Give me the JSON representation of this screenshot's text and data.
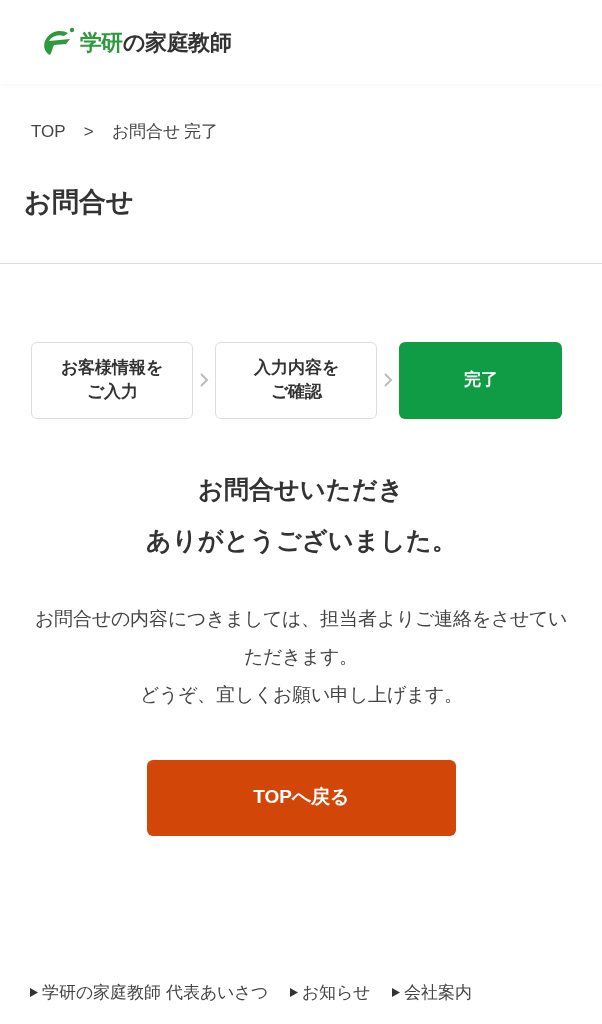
{
  "logo": {
    "accent": "学研",
    "rest": "の家庭教師"
  },
  "breadcrumb": [
    {
      "label": "TOP"
    },
    {
      "label": "お問合せ 完了"
    }
  ],
  "breadcrumb_separator": ">",
  "page_title": "お問合せ",
  "steps": [
    {
      "lines": [
        "お客様情報を",
        "ご入力"
      ],
      "selected": false
    },
    {
      "lines": [
        "入力内容を",
        "ご確認"
      ],
      "selected": false
    },
    {
      "lines": [
        "完了"
      ],
      "selected": true
    }
  ],
  "heading": [
    "お問合せいただき",
    "ありがとうございました。"
  ],
  "message": [
    "お問合せの内容につきましては、担当者よりご連絡をさせていただきます。",
    "どうぞ、宜しくお願い申し上げます。"
  ],
  "top_button": "TOPへ戻る",
  "footer_links": [
    "学研の家庭教師 代表あいさつ",
    "お知らせ",
    "会社案内"
  ]
}
